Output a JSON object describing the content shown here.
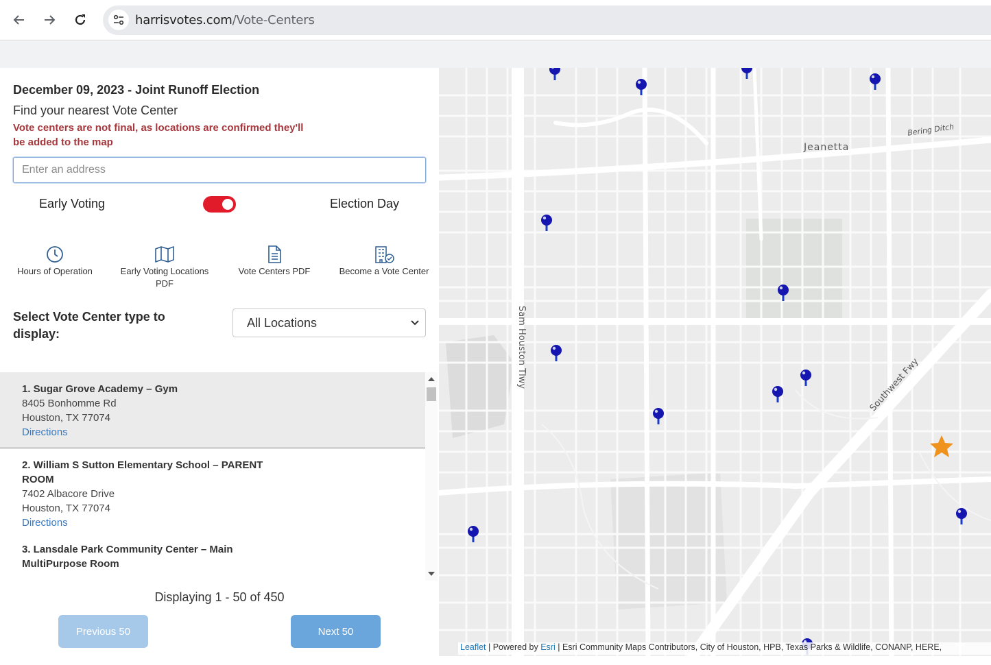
{
  "browser": {
    "url_domain": "harrisvotes.com",
    "url_path": "/Vote-Centers"
  },
  "header": {
    "title": "December 09, 2023 - Joint Runoff Election",
    "subtitle": "Find your nearest Vote Center",
    "warning": "Vote centers are not final, as locations are confirmed they'll be added to the map"
  },
  "search": {
    "placeholder": "Enter an address",
    "value": ""
  },
  "toggle": {
    "left_label": "Early Voting",
    "right_label": "Election Day",
    "on": true
  },
  "quick_links": [
    {
      "label": "Hours of Operation",
      "icon": "clock-icon"
    },
    {
      "label": "Early Voting Locations PDF",
      "icon": "map-icon"
    },
    {
      "label": "Vote Centers PDF",
      "icon": "document-icon"
    },
    {
      "label": "Become a Vote Center",
      "icon": "building-check-icon"
    }
  ],
  "filter": {
    "label": "Select Vote Center type to display:",
    "selected": "All Locations"
  },
  "locations": [
    {
      "name": "1. Sugar Grove Academy – Gym",
      "street": "8405 Bonhomme Rd",
      "city": "Houston, TX 77074",
      "link": "Directions"
    },
    {
      "name": "2. William S Sutton Elementary School – PARENT ROOM",
      "street": "7402 Albacore Drive",
      "city": "Houston, TX 77074",
      "link": "Directions"
    },
    {
      "name": "3. Lansdale Park Community Center – Main MultiPurpose Room",
      "street": "",
      "city": "",
      "link": ""
    }
  ],
  "pagination": {
    "status": "Displaying 1 - 50 of 450",
    "prev_label": "Previous 50",
    "next_label": "Next 50"
  },
  "map": {
    "labels": {
      "jeanetta": "Jeanetta",
      "bering": "Bering Ditch",
      "sam_houston": "Sam Houston Tlwy",
      "southwest": "Southwest Fwy"
    },
    "marker_color": "#1515b0",
    "star_color": "#f0921e",
    "attribution": {
      "leaflet": "Leaflet",
      "powered": " | Powered by ",
      "esri": "Esri",
      "rest": " | Esri Community Maps Contributors, City of Houston, HPB, Texas Parks & Wildlife, CONANP, HERE,"
    }
  }
}
